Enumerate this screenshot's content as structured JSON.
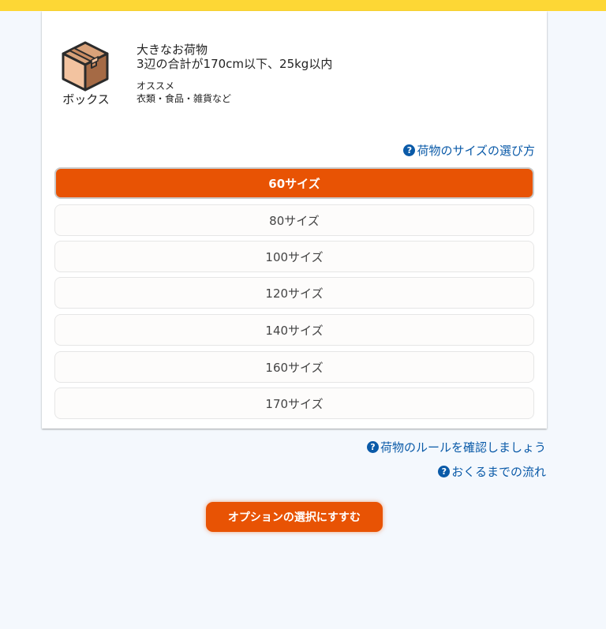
{
  "colors": {
    "top_bar": "#fdd735",
    "accent": "#e85304",
    "link": "#0a5aa8",
    "page_bg": "#f4f8fd"
  },
  "package": {
    "icon": "cardboard-box-icon",
    "type_label": "ボックス",
    "title": "大きなお荷物",
    "description": "3辺の合計が170cm以下、25kg以内",
    "recommend_label": "オススメ",
    "recommend_items": "衣類・食品・雑貨など"
  },
  "size_help": {
    "icon": "question-circle-icon",
    "label": "荷物のサイズの選び方"
  },
  "sizes": [
    {
      "label": "60サイズ",
      "selected": true
    },
    {
      "label": "80サイズ",
      "selected": false
    },
    {
      "label": "100サイズ",
      "selected": false
    },
    {
      "label": "120サイズ",
      "selected": false
    },
    {
      "label": "140サイズ",
      "selected": false
    },
    {
      "label": "160サイズ",
      "selected": false
    },
    {
      "label": "170サイズ",
      "selected": false
    }
  ],
  "links": {
    "rules": "荷物のルールを確認しましょう",
    "flow": "おくるまでの流れ"
  },
  "next_button": "オプションの選択にすすむ"
}
